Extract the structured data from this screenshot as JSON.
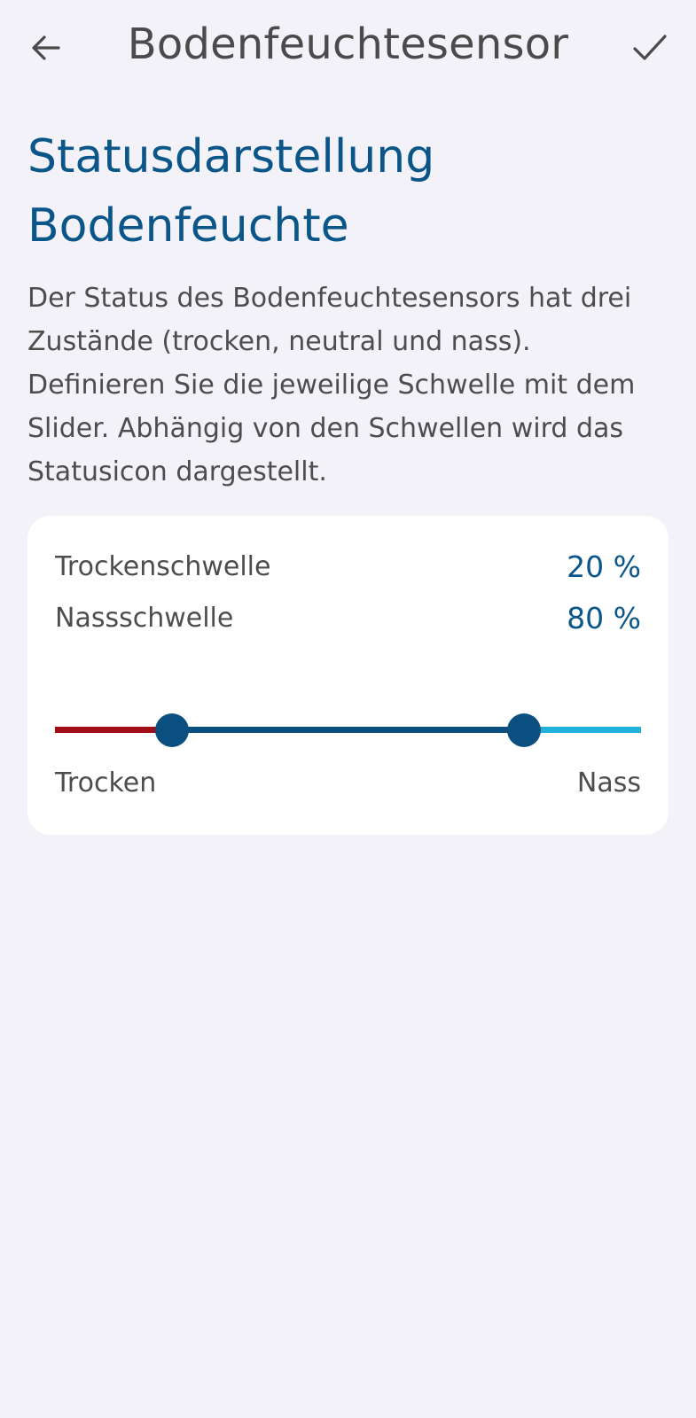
{
  "appbar": {
    "title": "Bodenfeuchtesensor",
    "back_icon": "arrow-left-icon",
    "confirm_icon": "check-icon"
  },
  "section": {
    "title": "Statusdarstellung Bodenfeuchte",
    "description": "Der Status des Bodenfeuchtesensors hat drei Zustände (trocken, neutral und nass). Definieren Sie die jeweilige Schwelle mit dem Slider. Abhängig von den Schwellen wird das Statusicon dargestellt."
  },
  "thresholds": {
    "dry_label": "Trockenschwelle",
    "dry_value": "20 %",
    "wet_label": "Nassschwelle",
    "wet_value": "80 %"
  },
  "slider": {
    "min": 0,
    "max": 100,
    "low": 20,
    "high": 80,
    "left_label": "Trocken",
    "right_label": "Nass",
    "colors": {
      "dry": "#a10d17",
      "neutral": "#0b4f80",
      "wet": "#1fb0dc"
    }
  },
  "colors": {
    "background": "#f3f2f9",
    "accent": "#0b5689",
    "card": "#ffffff"
  }
}
